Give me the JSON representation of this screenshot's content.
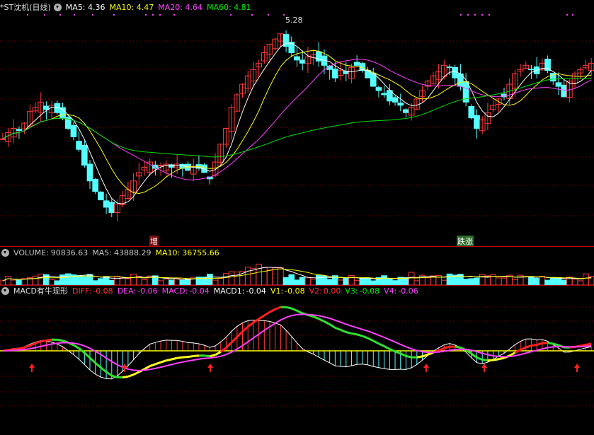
{
  "colors": {
    "up": "#ff3a3a",
    "down": "#54ffff",
    "ma5": "#ffffff",
    "ma10": "#ffff00",
    "ma20": "#ff40ff",
    "ma60": "#00e000",
    "grid": "#8b0000",
    "sep": "#b00000"
  },
  "price_header": {
    "title": "*ST沈机(日线)",
    "ma5_label": "MA5:",
    "ma5": "4.36",
    "ma10_label": "MA10:",
    "ma10": "4.47",
    "ma20_label": "MA20:",
    "ma20": "4.64",
    "ma60_label": "MA60:",
    "ma60": "4.81"
  },
  "price_annotation": "5.28",
  "markers": {
    "increase": "增",
    "up_down": "跌涨"
  },
  "volume_header": {
    "label": "VOLUME:",
    "value": "90836.63",
    "ma5_label": "MA5:",
    "ma5": "43888.29",
    "ma10_label": "MA10:",
    "ma10": "36755.66"
  },
  "macd_header": {
    "label": "MACD有牛现形",
    "diff_label": "DIFF:",
    "diff": "-0.08",
    "dea_label": "DEA:",
    "dea": "-0.06",
    "macd_label": "MACD:",
    "macd": "-0.04",
    "macd1_label": "MACD1:",
    "macd1": "-0.04",
    "v1_label": "V1:",
    "v1": "-0.08",
    "v2_label": "V2:",
    "v2": "0.00",
    "v3_label": "V3:",
    "v3": "-0.08",
    "v4_label": "V4:",
    "v4": "-0.06"
  },
  "icons": {
    "collapse": "chevron-down-circle-icon",
    "signal": "up-arrow-icon"
  },
  "chart_data": [
    {
      "type": "candlestick",
      "title": "*ST沈机(日线)",
      "series": [
        {
          "name": "MA5",
          "last": 4.36
        },
        {
          "name": "MA10",
          "last": 4.47
        },
        {
          "name": "MA20",
          "last": 4.64
        },
        {
          "name": "MA60",
          "last": 4.81
        }
      ],
      "ylim": [
        3.2,
        5.4
      ],
      "annotations": [
        {
          "text": "5.28",
          "value": 5.28
        }
      ],
      "seed": [
        4.2,
        4.26,
        4.3,
        4.28,
        4.35,
        4.46,
        4.5,
        4.55,
        4.48,
        4.52,
        4.45,
        4.4,
        4.3,
        4.22,
        4.1,
        3.95,
        3.8,
        3.7,
        3.62,
        3.55,
        3.5,
        3.58,
        3.66,
        3.72,
        3.8,
        3.88,
        3.93,
        3.98,
        3.92,
        3.95,
        3.96,
        3.93,
        3.96,
        3.92,
        3.9,
        3.94,
        3.92,
        3.88,
        3.82,
        3.98,
        4.15,
        4.3,
        4.5,
        4.62,
        4.72,
        4.8,
        4.86,
        4.92,
        5.02,
        5.1,
        5.15,
        5.2,
        5.08,
        5.02,
        4.95,
        4.92,
        4.98,
        5.0,
        4.94,
        4.9,
        4.86,
        4.78,
        4.85,
        4.82,
        4.88,
        4.9,
        4.85,
        4.78,
        4.7,
        4.66,
        4.62,
        4.56,
        4.55,
        4.52,
        4.45,
        4.5,
        4.58,
        4.66,
        4.75,
        4.8,
        4.84,
        4.9,
        4.88,
        4.78,
        4.7,
        4.55,
        4.4,
        4.3,
        4.38,
        4.45,
        4.52,
        4.58,
        4.6,
        4.72,
        4.82,
        4.86,
        4.9,
        4.86,
        4.82,
        4.92,
        4.85,
        4.75,
        4.7,
        4.6,
        4.75,
        4.82,
        4.86,
        4.9,
        4.92
      ]
    },
    {
      "type": "bar",
      "title": "VOLUME",
      "series": [
        {
          "name": "VOLUME",
          "last": 90836.63
        },
        {
          "name": "MA5",
          "last": 43888.29
        },
        {
          "name": "MA10",
          "last": 36755.66
        }
      ]
    },
    {
      "type": "line",
      "title": "MACD有牛现形",
      "series": [
        {
          "name": "DIFF",
          "last": -0.08
        },
        {
          "name": "DEA",
          "last": -0.06
        },
        {
          "name": "MACD",
          "last": -0.04
        },
        {
          "name": "MACD1",
          "last": -0.04
        },
        {
          "name": "V1",
          "last": -0.08
        },
        {
          "name": "V2",
          "last": 0.0
        },
        {
          "name": "V3",
          "last": -0.08
        },
        {
          "name": "V4",
          "last": -0.06
        }
      ],
      "ylim": [
        -0.35,
        0.35
      ]
    }
  ]
}
